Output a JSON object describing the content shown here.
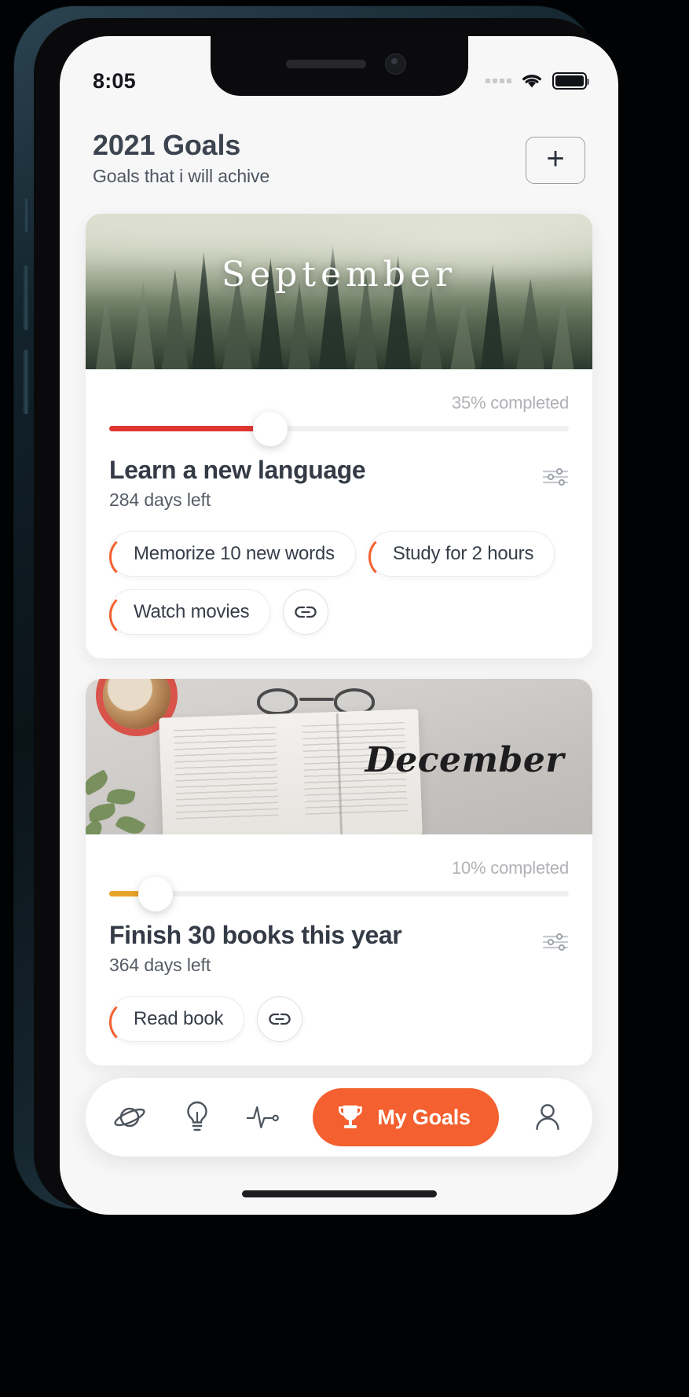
{
  "status_bar": {
    "time": "8:05",
    "wifi_icon": "wifi-icon",
    "battery_icon": "battery-full-icon",
    "signal_icon": "signal-dots-icon"
  },
  "header": {
    "title": "2021 Goals",
    "subtitle": "Goals that i will achive",
    "add_button_label": "+"
  },
  "goals": [
    {
      "month": "September",
      "hero_image": "misty-forest-photo",
      "progress_label": "35% completed",
      "progress_percent": 35,
      "progress_color": "#e0362f",
      "title": "Learn a new language",
      "days_left": "284 days left",
      "options_icon": "sliders-icon",
      "tasks": [
        "Memorize 10 new words",
        "Study for 2 hours",
        "Watch movies"
      ],
      "link_icon": "link-icon"
    },
    {
      "month": "December",
      "hero_image": "open-book-coffee-photo",
      "progress_label": "10% completed",
      "progress_percent": 10,
      "progress_color": "#e8a32a",
      "title": "Finish 30 books this year",
      "days_left": "364 days left",
      "options_icon": "sliders-icon",
      "tasks": [
        "Read book"
      ],
      "link_icon": "link-icon"
    }
  ],
  "bottom_nav": {
    "items": [
      {
        "icon": "planet-icon",
        "label": ""
      },
      {
        "icon": "lightbulb-icon",
        "label": ""
      },
      {
        "icon": "pulse-icon",
        "label": ""
      }
    ],
    "active": {
      "icon": "trophy-icon",
      "label": "My Goals",
      "color": "#f4602f"
    },
    "profile": {
      "icon": "person-icon",
      "label": ""
    }
  }
}
